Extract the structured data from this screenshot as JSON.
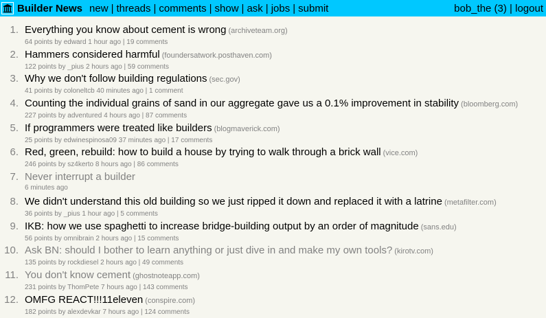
{
  "header": {
    "brand": "Builder News",
    "nav": [
      "new",
      "threads",
      "comments",
      "show",
      "ask",
      "jobs",
      "submit"
    ],
    "user": "bob_the (3)",
    "logout": "logout",
    "bar_color": "#00c8ff"
  },
  "items": [
    {
      "rank": "1.",
      "title": "Everything you know about cement is wrong",
      "domain": "(archiveteam.org)",
      "sub": "64 points by edward 1 hour ago | 19 comments",
      "visited": false
    },
    {
      "rank": "2.",
      "title": "Hammers considered harmful",
      "domain": "(foundersatwork.posthaven.com)",
      "sub": "122 points by _pius 2 hours ago | 59 comments",
      "visited": false
    },
    {
      "rank": "3.",
      "title": "Why we don't follow building regulations",
      "domain": "(sec.gov)",
      "sub": "41 points by coloneltcb 40 minutes ago | 1 comment",
      "visited": false
    },
    {
      "rank": "4.",
      "title": "Counting the individual grains of sand in our aggregate gave us a 0.1% improvement in stability",
      "domain": "(bloomberg.com)",
      "sub": "227 points by adventured 4 hours ago | 87 comments",
      "visited": false
    },
    {
      "rank": "5.",
      "title": "If programmers were treated like builders",
      "domain": "(blogmaverick.com)",
      "sub": "25 points by edwinespinosa09 37 minutes ago | 17 comments",
      "visited": false
    },
    {
      "rank": "6.",
      "title": "Red, green, rebuild: how to build a house by trying to walk through a brick wall",
      "domain": "(vice.com)",
      "sub": "246 points by sz4kerto 8 hours ago | 86 comments",
      "visited": false
    },
    {
      "rank": "7.",
      "title": "Never interrupt a builder",
      "domain": "",
      "sub": "6 minutes ago",
      "visited": true
    },
    {
      "rank": "8.",
      "title": "We didn't understand this old building so we just ripped it down and replaced it with a latrine",
      "domain": "(metafilter.com)",
      "sub": "36 points by _pius 1 hour ago | 5 comments",
      "visited": false
    },
    {
      "rank": "9.",
      "title": "IKB: how we use spaghetti to increase bridge-building output by an order of magnitude",
      "domain": "(sans.edu)",
      "sub": "56 points by omnibrain 2 hours ago | 15 comments",
      "visited": false
    },
    {
      "rank": "10.",
      "title": "Ask BN: should I bother to learn anything or just dive in and make my own tools?",
      "domain": "(kirotv.com)",
      "sub": "135 points by rockdiesel 2 hours ago | 49 comments",
      "visited": true
    },
    {
      "rank": "11.",
      "title": "You don't know cement",
      "domain": "(ghostnoteapp.com)",
      "sub": "231 points by ThomPete 7 hours ago | 143 comments",
      "visited": true
    },
    {
      "rank": "12.",
      "title": "OMFG REACT!!!11eleven",
      "domain": "(conspire.com)",
      "sub": "182 points by alexdevkar 7 hours ago | 124 comments",
      "visited": false
    }
  ]
}
